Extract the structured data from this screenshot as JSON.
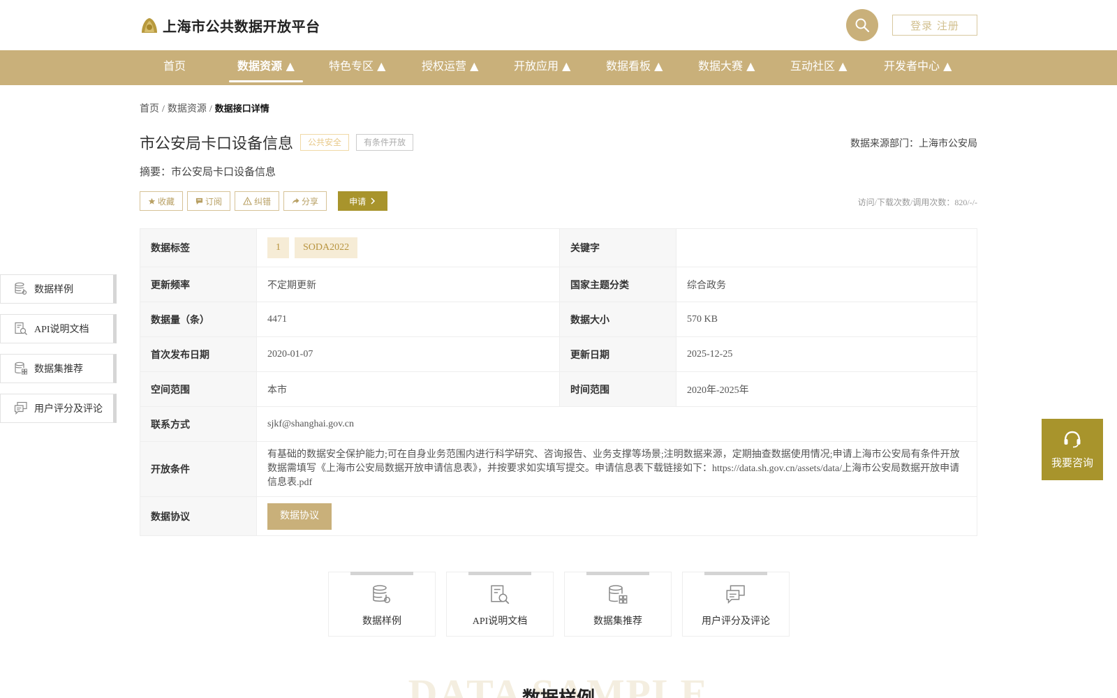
{
  "header": {
    "site_title": "上海市公共数据开放平台",
    "login_label": "登录 注册",
    "accent_color": "#c9b07a"
  },
  "nav": {
    "items": [
      {
        "label": "首页"
      },
      {
        "label": "数据资源 ▲"
      },
      {
        "label": "特色专区 ▲"
      },
      {
        "label": "授权运营 ▲"
      },
      {
        "label": "开放应用 ▲"
      },
      {
        "label": "数据看板 ▲"
      },
      {
        "label": "数据大赛 ▲"
      },
      {
        "label": "互动社区 ▲"
      },
      {
        "label": "开发者中心 ▲"
      }
    ],
    "active_index": 1
  },
  "breadcrumb": [
    "首页",
    "数据资源",
    "数据接口详情"
  ],
  "detail": {
    "title": "市公安局卡口设备信息",
    "tags": [
      "公共安全",
      "有条件开放"
    ],
    "source": "数据来源部门：上海市公安局",
    "summary": "摘要：市公安局卡口设备信息",
    "actions": [
      "收藏",
      "订阅",
      "纠错",
      "分享"
    ],
    "apply_label": "申请",
    "stats": "访问/下载次数/调用次数：820/-/-"
  },
  "table": {
    "data_tags_label": "数据标签",
    "data_tags": [
      "1",
      "SODA2022"
    ],
    "keyword_label": "关键字",
    "keyword_value": "",
    "rows": [
      {
        "l1": "更新频率",
        "v1": "不定期更新",
        "l2": "国家主题分类",
        "v2": "综合政务"
      },
      {
        "l1": "数据量（条）",
        "v1": "4471",
        "l2": "数据大小",
        "v2": "570 KB"
      },
      {
        "l1": "首次发布日期",
        "v1": "2020-01-07",
        "l2": "更新日期",
        "v2": "2025-12-25"
      },
      {
        "l1": "空间范围",
        "v1": "本市",
        "l2": "时间范围",
        "v2": "2020年-2025年"
      }
    ],
    "contact_label": "联系方式",
    "contact_value": "sjkf@shanghai.gov.cn",
    "condition_label": "开放条件",
    "condition_value": "有基础的数据安全保护能力;可在自身业务范围内进行科学研究、咨询报告、业务支撑等场景;注明数据来源，定期抽查数据使用情况;申请上海市公安局有条件开放数据需填写《上海市公安局数据开放申请信息表》，并按要求如实填写提交。申请信息表下载链接如下：https://data.sh.gov.cn/assets/data/上海市公安局数据开放申请信息表.pdf",
    "agreement_label": "数据协议",
    "agreement_button": "数据协议"
  },
  "side_nav": [
    "数据样例",
    "API说明文档",
    "数据集推荐",
    "用户评分及评论"
  ],
  "cards": [
    "数据样例",
    "API说明文档",
    "数据集推荐",
    "用户评分及评论"
  ],
  "consult_label": "我要咨询",
  "section": {
    "bg_text": "DATA SAMPLE",
    "title": "数据样例"
  }
}
